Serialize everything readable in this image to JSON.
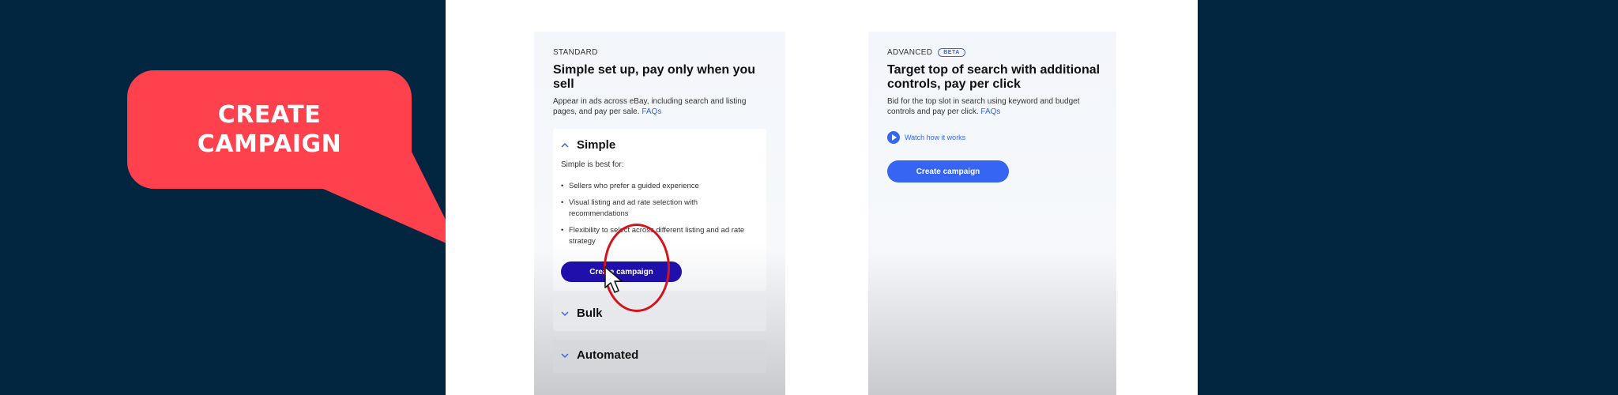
{
  "callout": {
    "line1": "CREATE",
    "line2": "CAMPAIGN",
    "color": "#fe414d"
  },
  "standard": {
    "eyebrow": "STANDARD",
    "title": "Simple set up, pay only when you sell",
    "description": "Appear in ads across eBay, including search and listing pages, and pay per sale.",
    "faqs": "FAQs",
    "sections": {
      "simple": {
        "label": "Simple",
        "subtitle": "Simple is best for:",
        "bullets": [
          "Sellers who prefer a guided experience",
          "Visual listing and ad rate selection with recommendations",
          "Flexibility to select across different listing and ad rate strategy"
        ],
        "button": "Create campaign"
      },
      "bulk": {
        "label": "Bulk"
      },
      "automated": {
        "label": "Automated"
      }
    }
  },
  "advanced": {
    "eyebrow": "ADVANCED",
    "badge": "BETA",
    "title": "Target top of search with additional controls, pay per click",
    "description": "Bid for the top slot in search using keyword and budget controls and pay per click.",
    "faqs": "FAQs",
    "watch": "Watch how it works",
    "button": "Create campaign"
  },
  "colors": {
    "background": "#02263f",
    "accent_blue": "#3665f3",
    "primary_button": "#2010ab",
    "highlight_ring": "#d4131c"
  },
  "icons": {
    "chevron_up": "chevron-up-icon",
    "chevron_down": "chevron-down-icon",
    "play": "play-icon",
    "cursor": "cursor-icon"
  }
}
